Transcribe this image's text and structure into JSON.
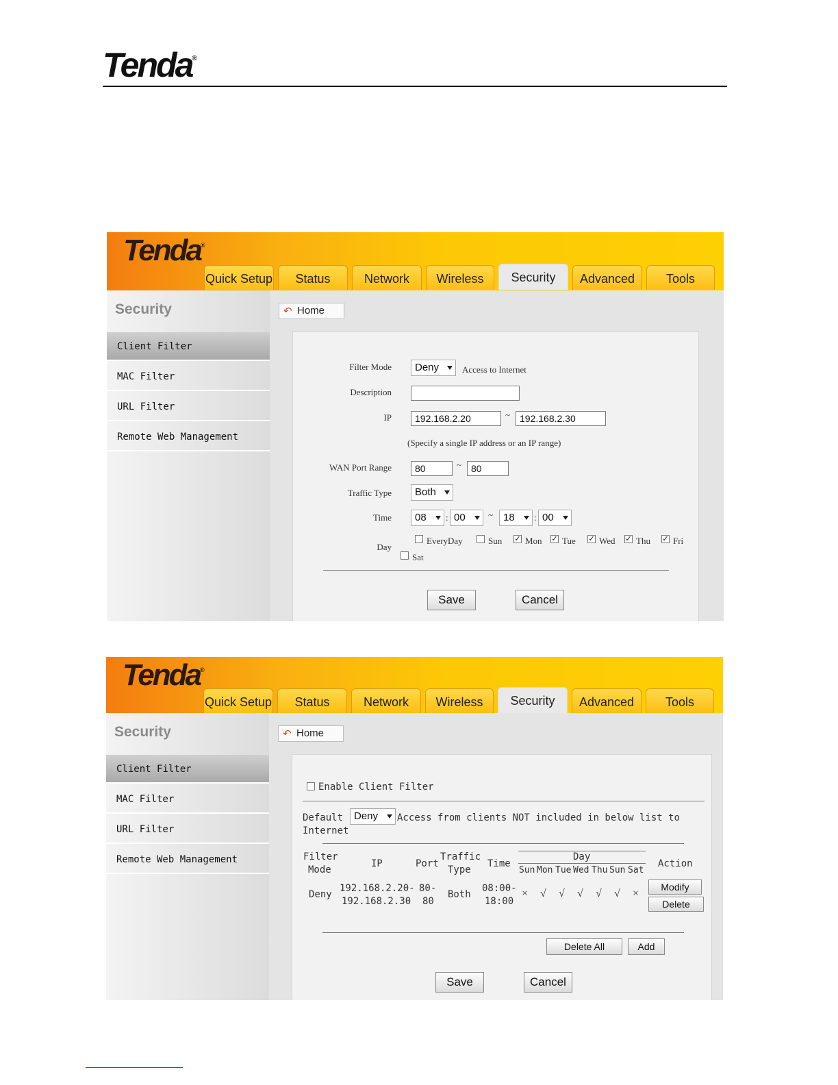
{
  "page": {
    "logo": "Tenda",
    "logo_mark": "®"
  },
  "nav": {
    "brand": "Tenda",
    "brand_mark": "®",
    "tabs": [
      "Quick Setup",
      "Status",
      "Network",
      "Wireless",
      "Security",
      "Advanced",
      "Tools"
    ],
    "active_tab": "Security"
  },
  "sidebar": {
    "title": "Security",
    "items": [
      "Client Filter",
      "MAC Filter",
      "URL Filter",
      "Remote Web Management"
    ],
    "active_item": "Client Filter"
  },
  "home_button": "Home",
  "form": {
    "filter_mode_label": "Filter Mode",
    "filter_mode_value": "Deny",
    "filter_mode_suffix": "Access to Internet",
    "description_label": "Description",
    "description_value": "",
    "ip_label": "IP",
    "ip_start": "192.168.2.20",
    "ip_end": "192.168.2.30",
    "range_sep": "~",
    "ip_hint": "(Specify a single IP address or an IP range)",
    "wan_port_label": "WAN Port Range",
    "port_start": "80",
    "port_end": "80",
    "traffic_type_label": "Traffic Type",
    "traffic_type_value": "Both",
    "time_label": "Time",
    "time_sep": ":",
    "start_hour": "08",
    "start_min": "00",
    "end_hour": "18",
    "end_min": "00",
    "day_label": "Day",
    "days": [
      {
        "label": "EveryDay",
        "checked": false
      },
      {
        "label": "Sun",
        "checked": false
      },
      {
        "label": "Mon",
        "checked": true
      },
      {
        "label": "Tue",
        "checked": true
      },
      {
        "label": "Wed",
        "checked": true
      },
      {
        "label": "Thu",
        "checked": true
      },
      {
        "label": "Fri",
        "checked": true
      },
      {
        "label": "Sat",
        "checked": false
      }
    ],
    "save": "Save",
    "cancel": "Cancel"
  },
  "list": {
    "enable_label": "Enable Client Filter",
    "enable_checked": false,
    "default_label": "Default",
    "default_value": "Deny",
    "default_suffix_1": "Access from clients NOT included in below list to",
    "default_suffix_2": "Internet",
    "headers": {
      "filter_mode_1": "Filter",
      "filter_mode_2": "Mode",
      "ip": "IP",
      "port": "Port",
      "traffic_1": "Traffic",
      "traffic_2": "Type",
      "time": "Time",
      "day": "Day",
      "days": [
        "Sun",
        "Mon",
        "Tue",
        "Wed",
        "Thu",
        "Sun",
        "Sat"
      ],
      "action": "Action"
    },
    "row": {
      "mode": "Deny",
      "ip_1": "192.168.2.20-",
      "ip_2": "192.168.2.30",
      "port_1": "80-",
      "port_2": "80",
      "traffic": "Both",
      "time_1": "08:00-",
      "time_2": "18:00",
      "day_marks": [
        "×",
        "√",
        "√",
        "√",
        "√",
        "√",
        "×"
      ],
      "modify": "Modify",
      "delete": "Delete"
    },
    "delete_all": "Delete All",
    "add": "Add",
    "save": "Save",
    "cancel": "Cancel"
  }
}
